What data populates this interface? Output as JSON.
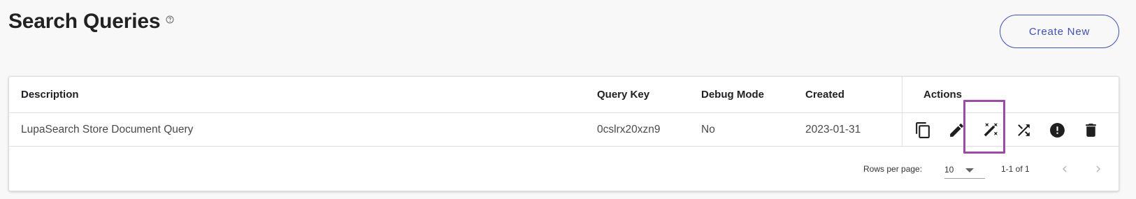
{
  "header": {
    "title": "Search Queries",
    "help_icon": "help-circle-outline-icon",
    "create_button": "Create New"
  },
  "table": {
    "columns": {
      "description": "Description",
      "query_key": "Query Key",
      "debug_mode": "Debug Mode",
      "created": "Created",
      "actions": "Actions"
    },
    "rows": [
      {
        "description": "LupaSearch Store Document Query",
        "query_key": "0cslrx20xzn9",
        "debug_mode": "No",
        "created": "2023-01-31",
        "actions": [
          "copy-icon",
          "pencil-icon",
          "auto-fix-wand-icon",
          "shuffle-icon",
          "alert-circle-icon",
          "trash-icon"
        ]
      }
    ]
  },
  "pagination": {
    "rows_per_page_label": "Rows per page:",
    "rows_per_page_value": "10",
    "range_text": "1-1 of 1"
  },
  "colors": {
    "accent": "#3f51b5",
    "highlight": "#9c4ba7",
    "background": "#f8f8f8"
  }
}
